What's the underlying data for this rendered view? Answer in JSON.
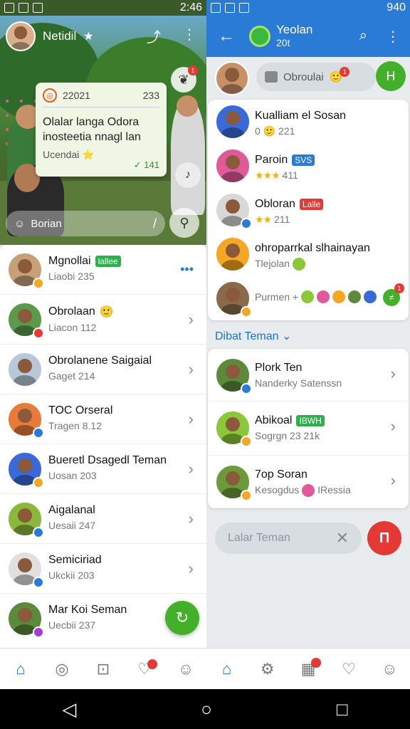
{
  "status_left": {
    "time": "2:46"
  },
  "status_right": {
    "time": "940"
  },
  "left": {
    "hero": {
      "title": "Netidil",
      "star": "★",
      "badge": "1",
      "card": {
        "code": "22021",
        "num": "233",
        "text": "Olalar langa Odora inosteetia nnagl lan",
        "sub": "Ucendai ⭐",
        "time": "✓ 141"
      },
      "bar_label": "Borian"
    },
    "list": [
      {
        "name": "Mgnollai",
        "tag": "lallee",
        "tag_color": "#2bb04a",
        "sub": "Liaobi 235",
        "more": "•••"
      },
      {
        "name": "Obrolaan",
        "emoji": "🙂",
        "sub": "Liacon 112"
      },
      {
        "name": "Obrolanene Saigaial",
        "sub": "Gaget 214"
      },
      {
        "name": "TOC Orseral",
        "sub": "Tragen 8.12"
      },
      {
        "name": "Bueretl Dsagedl Teman",
        "sub": "Uosan 203"
      },
      {
        "name": "Aigalanal",
        "sub": "Uesaii 247"
      },
      {
        "name": "Semiciriad",
        "sub": "Ukckii 203"
      },
      {
        "name": "Mar Koi Seman",
        "sub": "Uecbii 237"
      }
    ]
  },
  "right": {
    "header": {
      "title": "Yeolan",
      "subtitle": "20t"
    },
    "search": {
      "placeholder": "Obroulai",
      "badge": "1",
      "button": "H"
    },
    "top_list": [
      {
        "name": "Kualliam el Sosan",
        "sub": "0 🙂 221"
      },
      {
        "name": "Paroin",
        "tag": "SVS",
        "tag_color": "#2a7bd6",
        "stars": "★★★",
        "sub": "411"
      },
      {
        "name": "Obloran",
        "tag": "Lalle",
        "tag_color": "#e53935",
        "stars": "★★",
        "sub": "211"
      },
      {
        "name": "ohroparrkal slhainayan",
        "sub": "Tlejolan"
      },
      {
        "name": "Purmen +",
        "badge": "1"
      }
    ],
    "section_label": "Dibat Teman",
    "bottom_list": [
      {
        "name": "Plork Ten",
        "sub": "Nanderky Satenssn"
      },
      {
        "name": "Abikoal",
        "tag": "IBWH",
        "tag_color": "#2bb04a",
        "sub": "Sogrgn 23 21k"
      },
      {
        "name": "7op Soran",
        "sub": "Kesogdus",
        "sub2": "IRessia"
      }
    ],
    "input_placeholder": "Lalar Teman",
    "input_clear": "✕",
    "red_button": "П"
  },
  "colors": {
    "primary_blue": "#2a7bd6",
    "accent_green": "#43b02a",
    "alert_red": "#e53935"
  },
  "icons": {
    "left_nav": [
      "home-icon",
      "compass-icon",
      "mail-icon",
      "heart-icon",
      "profile-icon"
    ],
    "right_nav": [
      "home-icon",
      "settings-icon",
      "calendar-icon",
      "heart-icon",
      "profile-icon"
    ]
  }
}
